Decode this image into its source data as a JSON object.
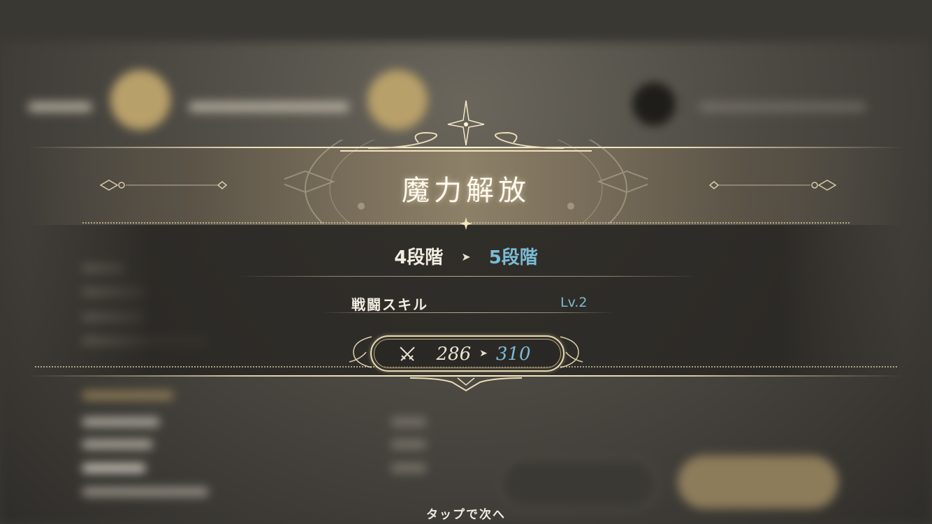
{
  "popup": {
    "title": "魔力解放",
    "stage_from": "4段階",
    "stage_to": "5段階",
    "skill_name": "戦闘スキル",
    "skill_level": "Lv.2",
    "stat_icon": "crossed-swords-icon",
    "stat_from": "286",
    "stat_to": "310",
    "arrow_glyph": "➤"
  },
  "footer": {
    "tap_hint": "タップで次へ"
  },
  "colors": {
    "gold": "#e9dcb8",
    "accent_blue": "#7bbcd6",
    "text_light": "#f2ede2"
  }
}
